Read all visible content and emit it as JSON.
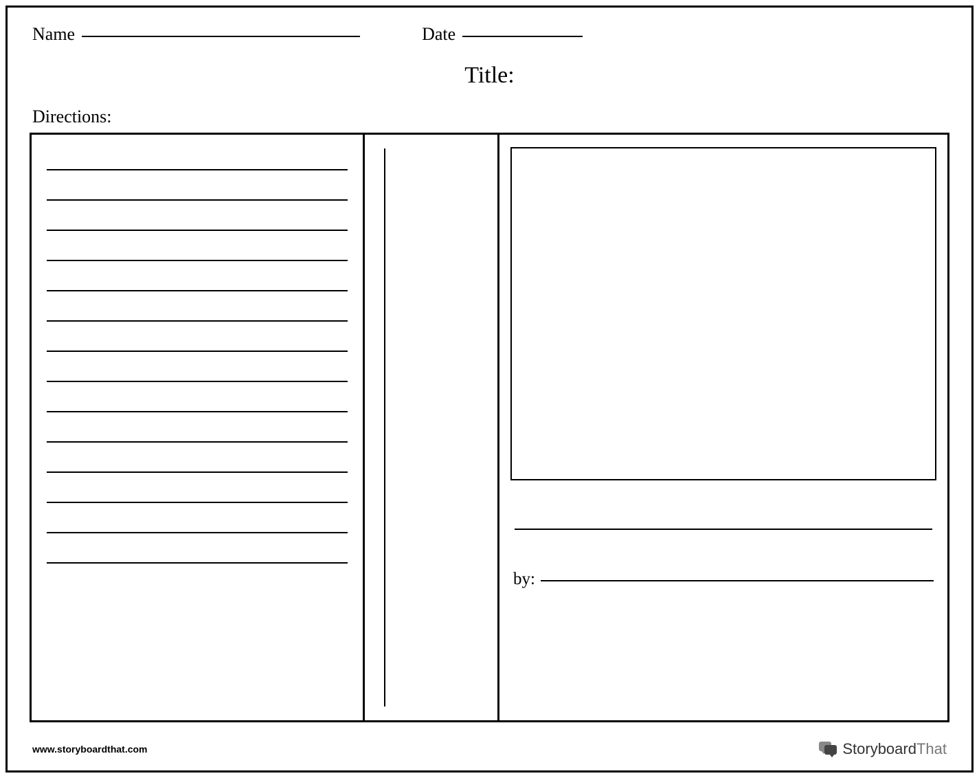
{
  "header": {
    "name_label": "Name",
    "date_label": "Date",
    "title_label": "Title:",
    "directions_label": "Directions:"
  },
  "worksheet": {
    "writing_line_count": 14,
    "by_label": "by:"
  },
  "footer": {
    "url": "www.storyboardthat.com",
    "logo_text_1": "Storyboard",
    "logo_text_2": "That"
  }
}
